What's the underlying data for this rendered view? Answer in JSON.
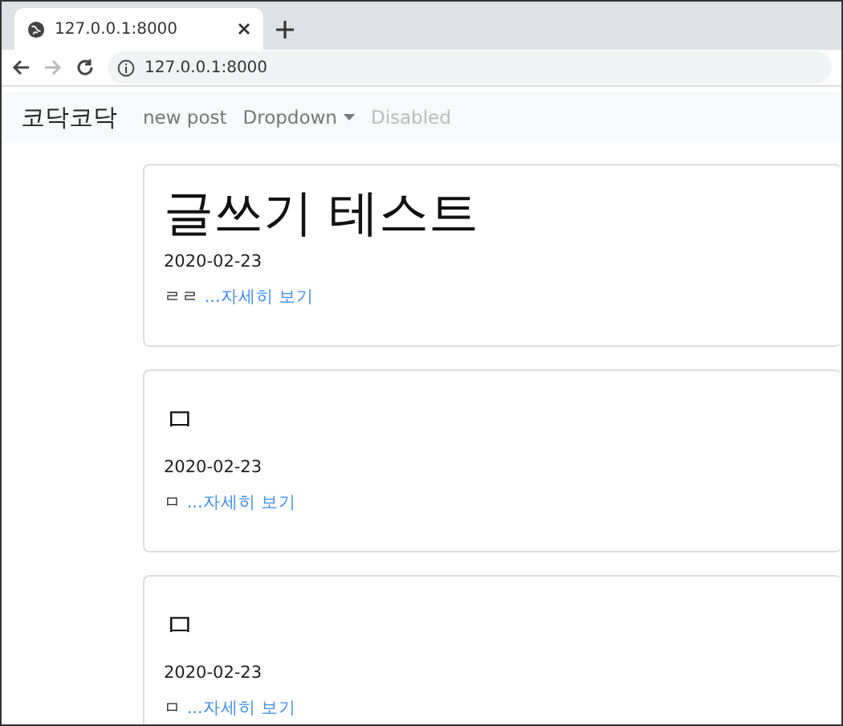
{
  "browser": {
    "tab_title": "127.0.0.1:8000",
    "url": "127.0.0.1:8000"
  },
  "navbar": {
    "brand": "코닥코닥",
    "items": [
      {
        "label": "new post",
        "kind": "link",
        "disabled": false
      },
      {
        "label": "Dropdown",
        "kind": "dropdown",
        "disabled": false
      },
      {
        "label": "Disabled",
        "kind": "link",
        "disabled": true
      }
    ]
  },
  "posts": [
    {
      "title": "글쓰기 테스트",
      "date": "2020-02-23",
      "excerpt": "ㄹㄹ",
      "more": "...자세히 보기"
    },
    {
      "title": "ㅁ",
      "date": "2020-02-23",
      "excerpt": "ㅁ",
      "more": "...자세히 보기"
    },
    {
      "title": "ㅁ",
      "date": "2020-02-23",
      "excerpt": "ㅁ",
      "more": "...자세히 보기"
    }
  ]
}
